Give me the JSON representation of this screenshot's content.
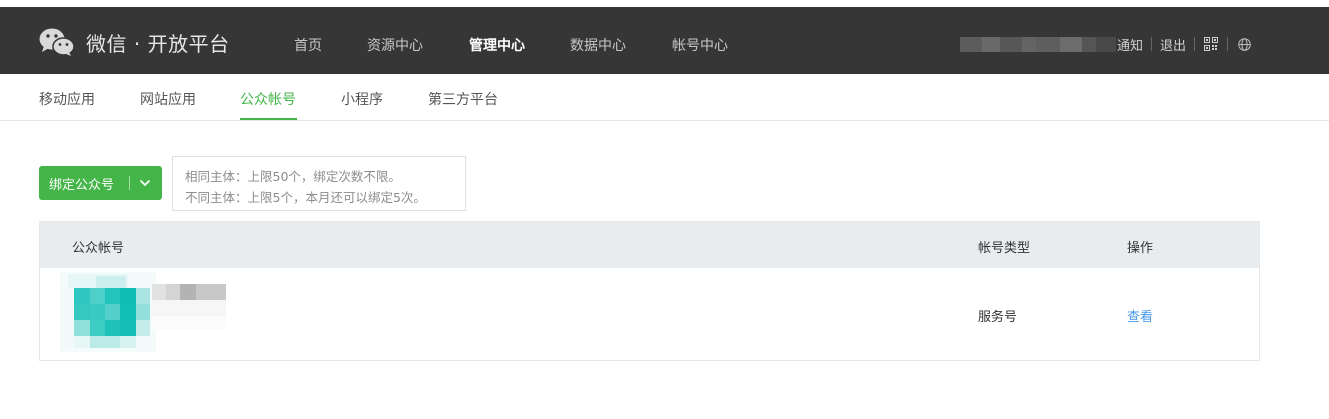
{
  "header": {
    "brand": "微信 · 开放平台",
    "nav": [
      "首页",
      "资源中心",
      "管理中心",
      "数据中心",
      "帐号中心"
    ],
    "active_nav": "管理中心",
    "notify": "通知",
    "logout": "退出"
  },
  "icons": {
    "logo": "wechat-logo-icon",
    "qr": "qrcode-icon",
    "globe": "globe-icon",
    "dropdown": "chevron-down-icon"
  },
  "subnav": {
    "items": [
      "移动应用",
      "网站应用",
      "公众帐号",
      "小程序",
      "第三方平台"
    ],
    "active": "公众帐号"
  },
  "actions": {
    "bind_label": "绑定公众号"
  },
  "tip": {
    "line1": "相同主体：上限50个，绑定次数不限。",
    "line2": "不同主体：上限5个，本月还可以绑定5次。"
  },
  "table": {
    "columns": [
      "公众帐号",
      "帐号类型",
      "操作"
    ],
    "rows": [
      {
        "type": "服务号",
        "action": "查看"
      }
    ]
  },
  "colors": {
    "topbar": "#363636",
    "accent": "#44b549",
    "link": "#459ae9",
    "table_header": "#e9ecef"
  }
}
